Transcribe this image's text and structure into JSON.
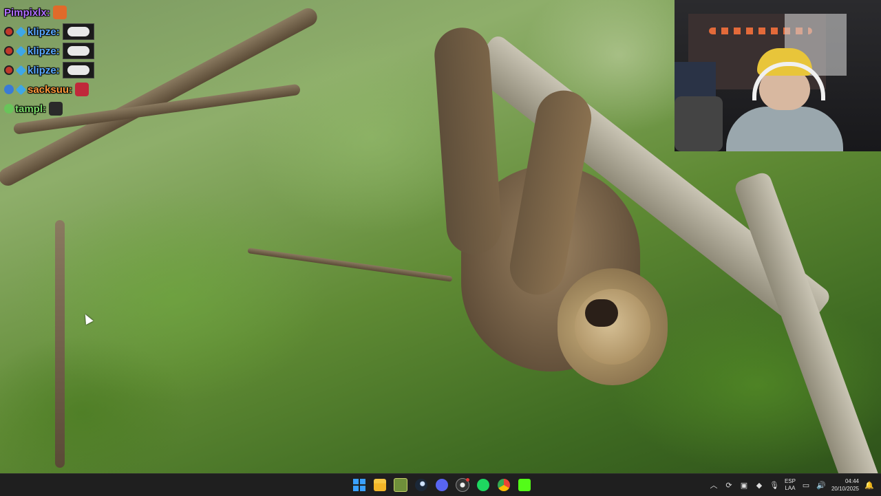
{
  "chat": {
    "messages": [
      {
        "user": "Pimpixlx:",
        "color": "#b070ff",
        "badges": [],
        "emote": "small-orange"
      },
      {
        "user": "klipze:",
        "color": "#5aa9ff",
        "badges": [
          "mod",
          "diamond"
        ],
        "emote": "cloud"
      },
      {
        "user": "klipze:",
        "color": "#5aa9ff",
        "badges": [
          "mod",
          "diamond"
        ],
        "emote": "cloud"
      },
      {
        "user": "klipze:",
        "color": "#5aa9ff",
        "badges": [
          "mod",
          "diamond"
        ],
        "emote": "cloud"
      },
      {
        "user": "sacksuu:",
        "color": "#ff9a3c",
        "badges": [
          "blue",
          "diamond"
        ],
        "emote": "small-red"
      },
      {
        "user": "tampl:",
        "color": "#7ddc6a",
        "badges": [
          "frog"
        ],
        "emote": "small-dark"
      }
    ]
  },
  "taskbar": {
    "apps": [
      {
        "name": "start-icon",
        "cls": "ico-start"
      },
      {
        "name": "file-explorer-icon",
        "cls": "ico-folder"
      },
      {
        "name": "game-launcher-icon",
        "cls": "ico-game"
      },
      {
        "name": "steam-icon",
        "cls": "ico-steam"
      },
      {
        "name": "discord-icon",
        "cls": "ico-discord"
      },
      {
        "name": "obs-icon",
        "cls": "ico-obs",
        "recording": true
      },
      {
        "name": "spotify-icon",
        "cls": "ico-spotify"
      },
      {
        "name": "chrome-icon",
        "cls": "ico-chrome"
      },
      {
        "name": "kick-icon",
        "cls": "ico-kick"
      }
    ],
    "tray": {
      "lang_top": "ESP",
      "lang_bottom": "LAA",
      "time": "04:44",
      "date": "20/10/2025",
      "icons": [
        "chevron-up-icon",
        "sync-icon",
        "app-tray-icon",
        "shield-icon",
        "microphone-icon"
      ]
    }
  }
}
